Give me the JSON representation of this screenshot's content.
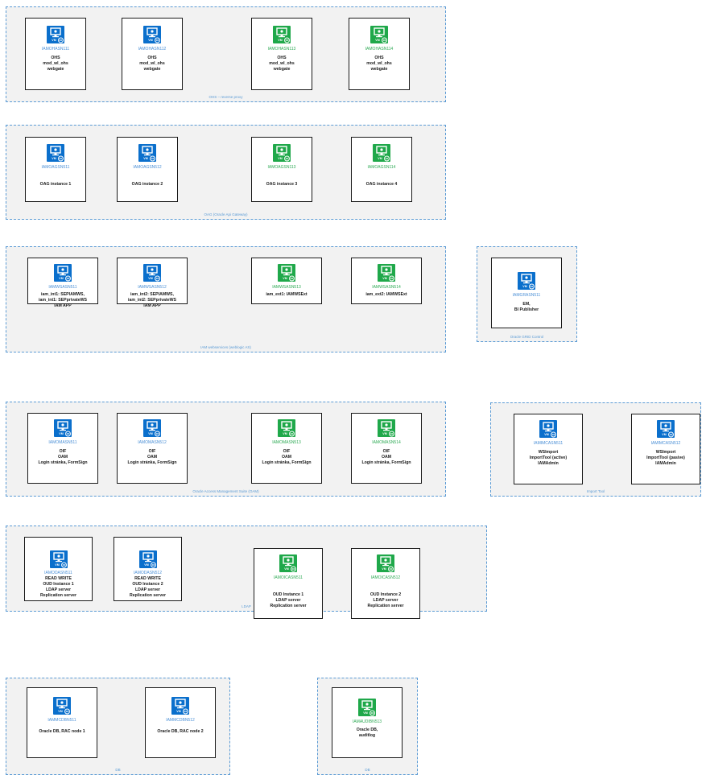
{
  "vm_badge": "VM",
  "colors": {
    "blue": "#0a6fcc",
    "green": "#1fa84a",
    "group_border": "#5b9bd5"
  },
  "groups": [
    {
      "label": "OHS – reverse proxy",
      "nodes": [
        {
          "color": "blue",
          "host": "IAMOHASN111",
          "lines": [
            "OHS",
            "mod_wl_ohs",
            "webgate"
          ]
        },
        {
          "color": "blue",
          "host": "IAMOHASN112",
          "lines": [
            "OHS",
            "mod_wl_ohs",
            "webgate"
          ]
        },
        {
          "color": "green",
          "host": "IAMOHASN113",
          "lines": [
            "OHS",
            "mod_wl_ohs",
            "webgate"
          ]
        },
        {
          "color": "green",
          "host": "IAMOHASN114",
          "lines": [
            "OHS",
            "mod_wl_ohs",
            "webgate"
          ]
        }
      ]
    },
    {
      "label": "OAG (Oracle Api Gateway)",
      "nodes": [
        {
          "color": "blue",
          "host": "IAMOAGSN511",
          "lines": [
            "OAG instance 1"
          ]
        },
        {
          "color": "blue",
          "host": "IAMOAGSN512",
          "lines": [
            "OAG instance 2"
          ]
        },
        {
          "color": "green",
          "host": "IAMOAGSN113",
          "lines": [
            "OAG instance 3"
          ]
        },
        {
          "color": "green",
          "host": "IAMOAGSN114",
          "lines": [
            "OAG instance 4"
          ]
        }
      ]
    },
    {
      "label": "IAM webservices (weblogic AS)",
      "nodes": [
        {
          "color": "blue",
          "host": "IAMWSASN511",
          "lines": [
            "iam_int1: SEPIAMWS,",
            "iam_int1: SEPprivateWS",
            "IAM APP"
          ]
        },
        {
          "color": "blue",
          "host": "IAMWSASN512",
          "lines": [
            "iam_int2: SEPIAMWS,",
            "iam_int2: SEPprivateWS",
            "IAM APP"
          ]
        },
        {
          "color": "green",
          "host": "IAMWSASN513",
          "lines": [
            "iam_ext1: IAMWSExt"
          ]
        },
        {
          "color": "green",
          "host": "IAMWSASN514",
          "lines": [
            "iam_ext2: IAMWSExt"
          ]
        }
      ]
    },
    {
      "label": "Oracle GRID Control",
      "nodes": [
        {
          "color": "blue",
          "host": "IAMGRASN511",
          "lines": [
            "EM,",
            "BI Publisher"
          ]
        }
      ]
    },
    {
      "label": "Oracle Access Management Suite (OAM)",
      "nodes": [
        {
          "color": "blue",
          "host": "IAMOMASN511",
          "lines": [
            "OIF",
            "OAM",
            "Login stránka, FormSign"
          ]
        },
        {
          "color": "blue",
          "host": "IAMOMASN512",
          "lines": [
            "OIF",
            "OAM",
            "Login stránka, FormSign"
          ]
        },
        {
          "color": "green",
          "host": "IAMOMASN513",
          "lines": [
            "OIF",
            "OAM",
            "Login stránka, FormSign"
          ]
        },
        {
          "color": "green",
          "host": "IAMOMASN514",
          "lines": [
            "OIF",
            "OAM",
            "Login stránka, FormSign"
          ]
        }
      ]
    },
    {
      "label": "Import Tool",
      "nodes": [
        {
          "color": "blue",
          "host": "IAMIMCASN511",
          "lines": [
            "WSImport",
            "ImportTool (active)",
            "IAMAdmin"
          ]
        },
        {
          "color": "blue",
          "host": "IAMIMCASN512",
          "lines": [
            "WSImport",
            "ImportTool (pasive)",
            "IAMAdmin"
          ]
        }
      ]
    },
    {
      "label": "LDAP",
      "nodes": [
        {
          "color": "blue",
          "host": "IAMODASN511",
          "lines": [
            "READ WRITE",
            "OUD Instance 1",
            "LDAP server",
            "Replication server"
          ]
        },
        {
          "color": "blue",
          "host": "IAMODASN512",
          "lines": [
            "READ WRITE",
            "OUD Instance 2",
            "LDAP server",
            "Replication server"
          ]
        },
        {
          "color": "green",
          "host": "IAMOICASN511",
          "lines": [
            "OUD Instance 1",
            "LDAP server",
            "Replication server"
          ]
        },
        {
          "color": "green",
          "host": "IAMOICASN512",
          "lines": [
            "OUD Instance 2",
            "LDAP server",
            "Replication server"
          ]
        }
      ]
    },
    {
      "label": "DB",
      "nodes": [
        {
          "color": "blue",
          "host": "IAMMCDBN511",
          "lines": [
            "Oracle DB, RAC node 1"
          ]
        },
        {
          "color": "blue",
          "host": "IAMMCDBN512",
          "lines": [
            "Oracle DB, RAC node 2"
          ]
        }
      ]
    },
    {
      "label": "DB",
      "nodes": [
        {
          "color": "green",
          "host": "IAMAUDIBN513",
          "lines": [
            "Oracle DB,",
            "auditlog"
          ]
        }
      ]
    }
  ]
}
